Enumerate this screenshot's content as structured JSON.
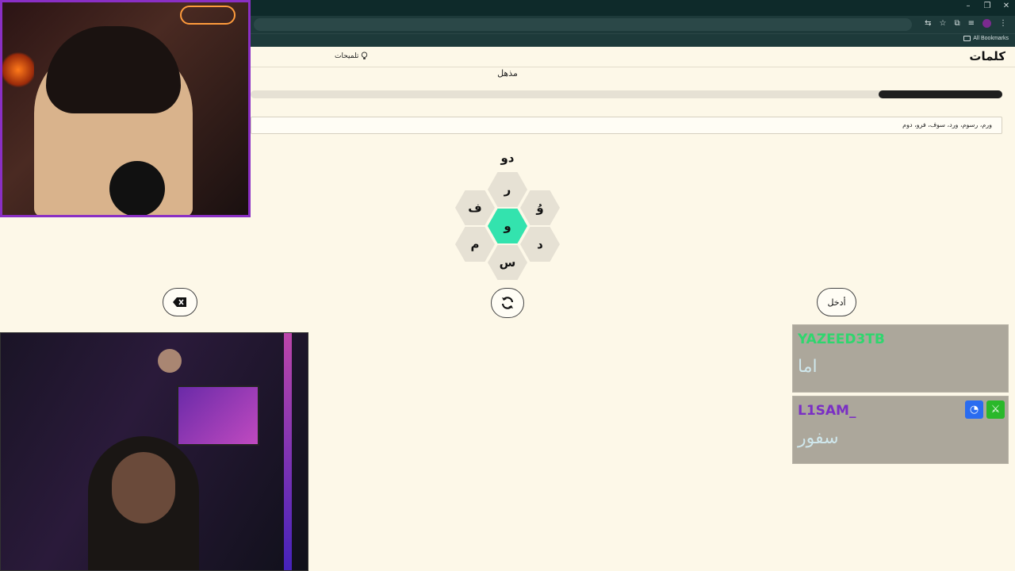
{
  "browser": {
    "bookmarks_label": "All Bookmarks"
  },
  "app": {
    "title": "كلمات",
    "hints_label": "تلميحات",
    "rank": "مذهل",
    "progress_fraction": 0.165,
    "found_words": "ورم، رسوم، ورد، سوف، فرو، دوم",
    "current_word": "دو"
  },
  "hive": {
    "top": "ر",
    "upper_left": "ف",
    "upper_right": "وُ",
    "center": "و",
    "lower_left": "م",
    "lower_right": "د",
    "bottom": "س"
  },
  "buttons": {
    "enter_label": "أدخل"
  },
  "chat": [
    {
      "user": "YAZEED3TB",
      "color": "#2fd66e",
      "message": "اما"
    },
    {
      "user": "L1SAM_",
      "color": "#7a2fc4",
      "message": "سفور"
    }
  ],
  "colors": {
    "accent": "#33e3ae",
    "stream_border": "#8a2fc4"
  }
}
